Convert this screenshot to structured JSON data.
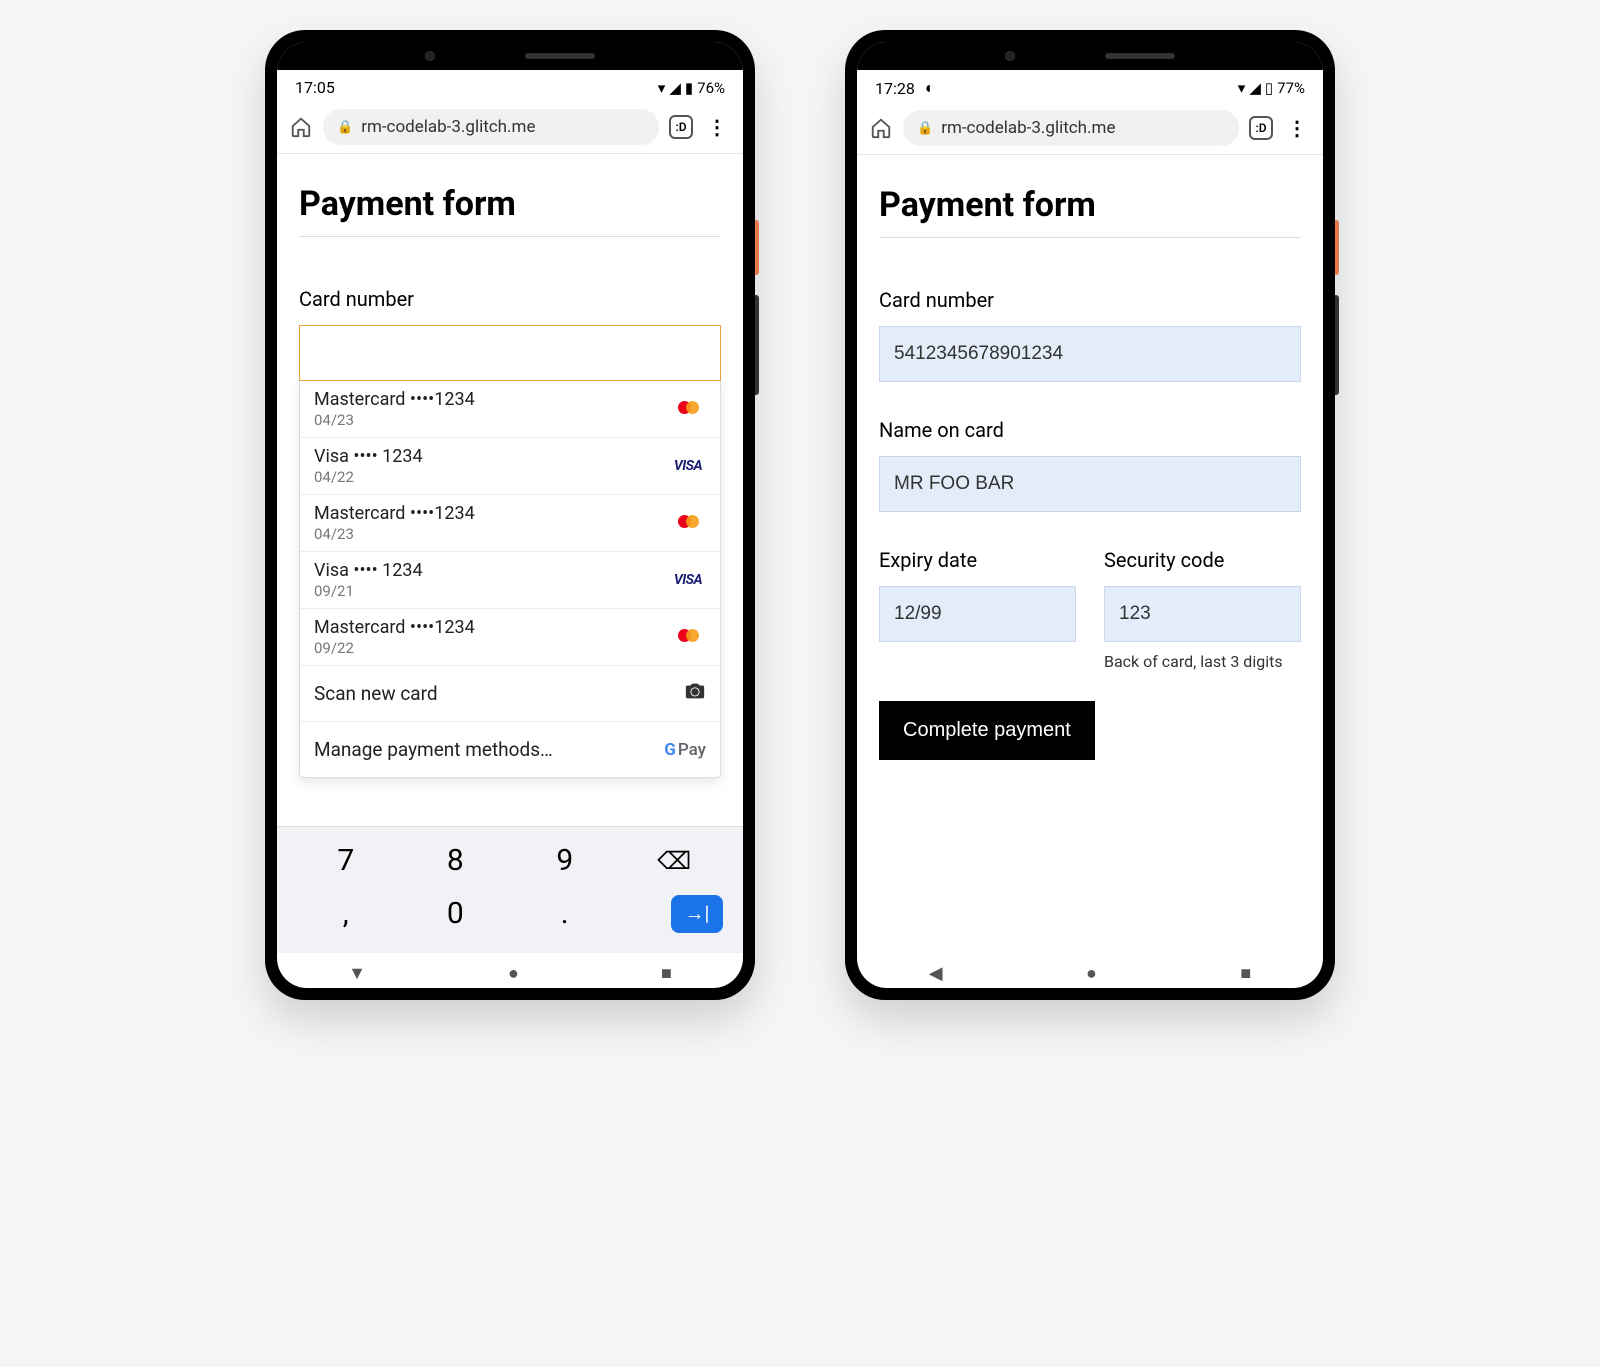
{
  "phone1": {
    "status": {
      "time": "17:05",
      "battery": "76%"
    },
    "browser": {
      "url": "rm-codelab-3.glitch.me",
      "tab_badge": ":D"
    },
    "page_title": "Payment form",
    "card_number_label": "Card number",
    "autofill": {
      "items": [
        {
          "main": "Mastercard  ••••1234",
          "sub": "04/23",
          "brand": "mastercard"
        },
        {
          "main": "Visa  •••• 1234",
          "sub": "04/22",
          "brand": "visa"
        },
        {
          "main": "Mastercard  ••••1234",
          "sub": "04/23",
          "brand": "mastercard"
        },
        {
          "main": "Visa  •••• 1234",
          "sub": "09/21",
          "brand": "visa"
        },
        {
          "main": "Mastercard  ••••1234",
          "sub": "09/22",
          "brand": "mastercard"
        }
      ],
      "scan_label": "Scan new card",
      "manage_label": "Manage payment methods…",
      "gpay_label": "Pay"
    },
    "keyboard": {
      "row1": [
        "7",
        "8",
        "9"
      ],
      "row2": [
        ",",
        "0",
        "."
      ]
    }
  },
  "phone2": {
    "status": {
      "time": "17:28",
      "battery": "77%"
    },
    "browser": {
      "url": "rm-codelab-3.glitch.me",
      "tab_badge": ":D"
    },
    "page_title": "Payment form",
    "fields": {
      "card_number_label": "Card number",
      "card_number_value": "5412345678901234",
      "name_label": "Name on card",
      "name_value": "MR FOO BAR",
      "expiry_label": "Expiry date",
      "expiry_value": "12/99",
      "cvc_label": "Security code",
      "cvc_value": "123",
      "cvc_hint": "Back of card, last 3 digits"
    },
    "submit_label": "Complete payment"
  }
}
